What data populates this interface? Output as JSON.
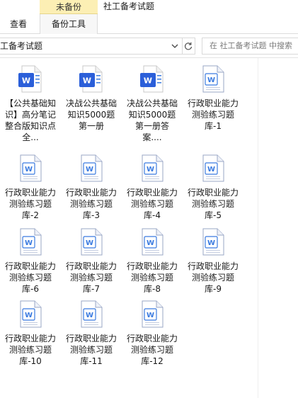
{
  "ribbon": {
    "context_tab_label": "未备份",
    "window_title": "社工备考试题",
    "tabs": [
      {
        "label": "查看"
      },
      {
        "label": "备份工具"
      }
    ]
  },
  "address_bar": {
    "path_text": "工备考试题"
  },
  "search": {
    "placeholder": "在 社工备考试题 中搜索"
  },
  "colors": {
    "word_blue_dark": "#2b5fd9",
    "word_blue_light": "#3b7be0",
    "context_tab_bg": "#fcefb4"
  },
  "files": [
    {
      "label": "【公共基础知识】高分笔记整合版知识点全...",
      "icon": "word-doc-icon-filled"
    },
    {
      "label": "决战公共基础知识5000题第一册",
      "icon": "word-doc-icon-filled"
    },
    {
      "label": "决战公共基础知识5000题第一册答案....",
      "icon": "word-doc-icon-filled"
    },
    {
      "label": "行政职业能力测验练习题库-1",
      "icon": "word-doc-icon-outline"
    },
    {
      "label": "行政职业能力测验练习题库-2",
      "icon": "word-doc-icon-outline"
    },
    {
      "label": "行政职业能力测验练习题库-3",
      "icon": "word-doc-icon-outline"
    },
    {
      "label": "行政职业能力测验练习题库-4",
      "icon": "word-doc-icon-outline"
    },
    {
      "label": "行政职业能力测验练习题库-5",
      "icon": "word-doc-icon-outline"
    },
    {
      "label": "行政职业能力测验练习题库-6",
      "icon": "word-doc-icon-outline"
    },
    {
      "label": "行政职业能力测验练习题库-7",
      "icon": "word-doc-icon-outline"
    },
    {
      "label": "行政职业能力测验练习题库-8",
      "icon": "word-doc-icon-outline"
    },
    {
      "label": "行政职业能力测验练习题库-9",
      "icon": "word-doc-icon-outline"
    },
    {
      "label": "行政职业能力测验练习题库-10",
      "icon": "word-doc-icon-outline"
    },
    {
      "label": "行政职业能力测验练习题库-11",
      "icon": "word-doc-icon-outline"
    },
    {
      "label": "行政职业能力测验练习题库-12",
      "icon": "word-doc-icon-outline"
    }
  ]
}
